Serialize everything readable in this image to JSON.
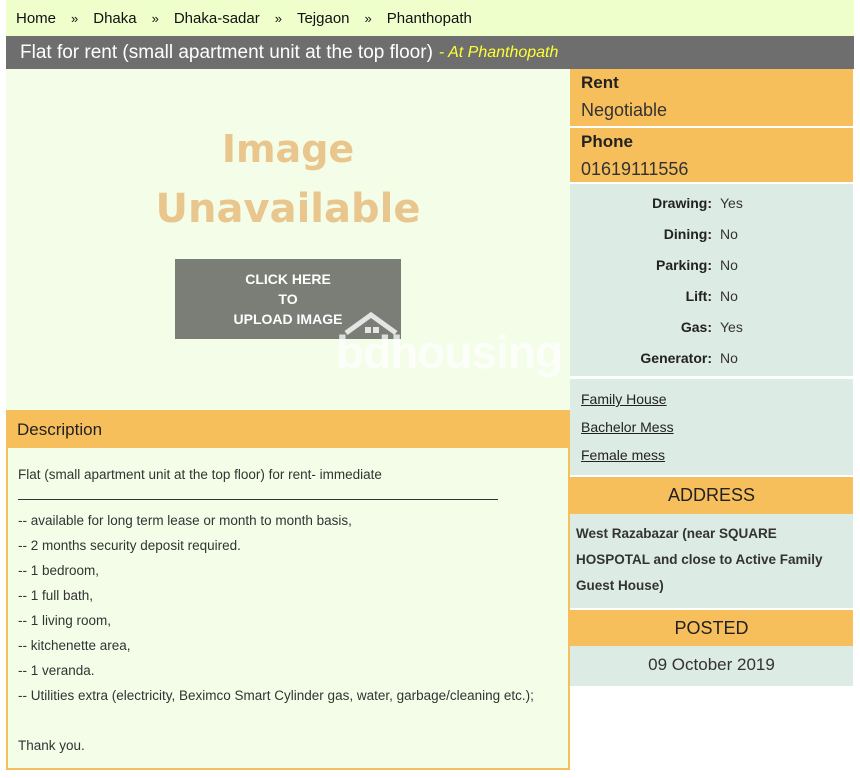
{
  "breadcrumb": {
    "items": [
      "Home",
      "Dhaka",
      "Dhaka-sadar",
      "Tejgaon",
      "Phanthopath"
    ],
    "separator": "»"
  },
  "listing": {
    "title": "Flat for rent (small apartment unit at the top floor)",
    "location": "- At Phanthopath"
  },
  "image": {
    "placeholder_line1": "Image",
    "placeholder_line2": "Unavailable",
    "upload_line1": "CLICK HERE",
    "upload_line2": "TO",
    "upload_line3": "UPLOAD IMAGE",
    "watermark": "bdhousing"
  },
  "description": {
    "heading": "Description",
    "intro": "Flat (small apartment unit at the top floor) for rent- immediate",
    "lines": [
      "-- available for long term lease or month to month basis,",
      "-- 2 months security deposit required.",
      "-- 1 bedroom,",
      "-- 1 full bath,",
      "-- 1 living room,",
      "-- kitchenette area,",
      "-- 1 veranda.",
      "-- Utilities extra (electricity, Beximco Smart Cylinder gas, water, garbage/cleaning etc.);"
    ],
    "closing": "Thank you."
  },
  "rent": {
    "label": "Rent",
    "value": "Negotiable"
  },
  "phone": {
    "label": "Phone",
    "value": "01619111556"
  },
  "features": [
    {
      "label": "Drawing:",
      "value": "Yes"
    },
    {
      "label": "Dining:",
      "value": "No"
    },
    {
      "label": "Parking:",
      "value": "No"
    },
    {
      "label": "Lift:",
      "value": "No"
    },
    {
      "label": "Gas:",
      "value": "Yes"
    },
    {
      "label": "Generator:",
      "value": "No"
    }
  ],
  "tags": [
    "Family House",
    "Bachelor Mess",
    "Female mess"
  ],
  "address": {
    "heading": "ADDRESS",
    "text": "West Razabazar (near SQUARE HOSPOTAL and close to Active Family Guest House)"
  },
  "posted": {
    "heading": "POSTED",
    "date": "09 October 2019"
  },
  "colors": {
    "breadcrumb_bg": "#eeffcc",
    "title_bg": "#6e6e6e",
    "location_text": "#ffff33",
    "accent_orange": "#f7be5c",
    "panel_green": "#dcebe3",
    "content_bg": "#f3fde7",
    "upload_button_bg": "#7b7d77",
    "placeholder_text": "#e8c68e"
  }
}
